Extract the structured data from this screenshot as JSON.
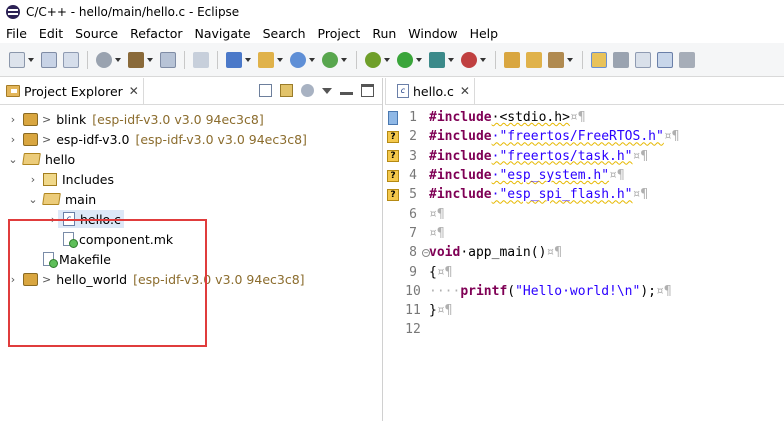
{
  "window": {
    "title": "C/C++ - hello/main/hello.c - Eclipse"
  },
  "menu": [
    "File",
    "Edit",
    "Source",
    "Refactor",
    "Navigate",
    "Search",
    "Project",
    "Run",
    "Window",
    "Help"
  ],
  "project_explorer": {
    "tab_label": "Project Explorer",
    "close": "✕",
    "items": [
      {
        "label": "blink",
        "meta": "[esp-idf-v3.0 v3.0 94ec3c8]"
      },
      {
        "label": "esp-idf-v3.0",
        "meta": "[esp-idf-v3.0 v3.0 94ec3c8]"
      },
      {
        "label": "hello"
      },
      {
        "label": "Includes"
      },
      {
        "label": "main"
      },
      {
        "label": "hello.c"
      },
      {
        "label": "component.mk"
      },
      {
        "label": "Makefile"
      },
      {
        "label": "hello_world",
        "meta": "[esp-idf-v3.0 v3.0 94ec3c8]"
      }
    ]
  },
  "editor": {
    "tab_label": "hello.c",
    "close": "✕",
    "line_numbers": [
      "1",
      "2",
      "3",
      "4",
      "5",
      "6",
      "7",
      "8",
      "9",
      "10",
      "11",
      "12"
    ],
    "lines": [
      {
        "kw": "#include",
        "rest": "·<stdio.h>",
        "end": "¤¶"
      },
      {
        "kw": "#include",
        "rest": "·\"freertos/FreeRTOS.h\"",
        "end": "¤¶"
      },
      {
        "kw": "#include",
        "rest": "·\"freertos/task.h\"",
        "end": "¤¶"
      },
      {
        "kw": "#include",
        "rest": "·\"esp_system.h\"",
        "end": "¤¶"
      },
      {
        "kw": "#include",
        "rest": "·\"esp_spi_flash.h\"",
        "end": "¤¶"
      },
      {
        "kw": "",
        "rest": "",
        "end": "¤¶"
      },
      {
        "kw": "",
        "rest": "",
        "end": "¤¶"
      },
      {
        "kw": "void",
        "rest": "·app_main()",
        "end": "¤¶"
      },
      {
        "kw": "",
        "rest": "{",
        "end": "¤¶"
      },
      {
        "kw": "",
        "rest": "····printf(\"Hello·world!\\n\");",
        "end": "¤¶"
      },
      {
        "kw": "",
        "rest": "}",
        "end": "¤¶"
      },
      {
        "kw": "",
        "rest": "",
        "end": ""
      }
    ]
  },
  "colors": {
    "keyword": "#7f0055",
    "string": "#2a00ff",
    "highlight_box": "#e03c3c"
  }
}
